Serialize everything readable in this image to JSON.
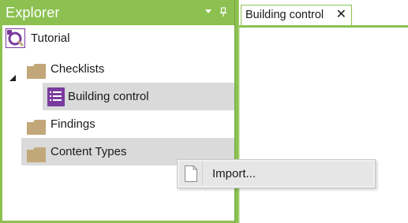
{
  "explorer": {
    "title": "Explorer",
    "dropdown_icon": "dropdown-arrow-icon",
    "pin_icon": "pin-icon",
    "tree": {
      "root": {
        "label": "Tutorial",
        "icon": "tutorial-app-icon"
      },
      "items": [
        {
          "label": "Checklists",
          "icon": "folder-icon",
          "expanded": true
        },
        {
          "label": "Building control",
          "icon": "checklist-icon",
          "selected": true
        },
        {
          "label": "Findings",
          "icon": "folder-icon"
        },
        {
          "label": "Content Types",
          "icon": "folder-icon",
          "highlighted": true
        }
      ]
    }
  },
  "document": {
    "tabs": [
      {
        "label": "Building control",
        "close_icon": "close-icon"
      }
    ]
  },
  "context_menu": {
    "items": [
      {
        "label": "Import...",
        "icon": "document-icon"
      }
    ]
  },
  "colors": {
    "accent": "#8cc152",
    "folder": "#c2a77a",
    "checklist_icon": "#7a3b9e",
    "selection": "#dadada",
    "menu_background": "#f0f0f0"
  }
}
